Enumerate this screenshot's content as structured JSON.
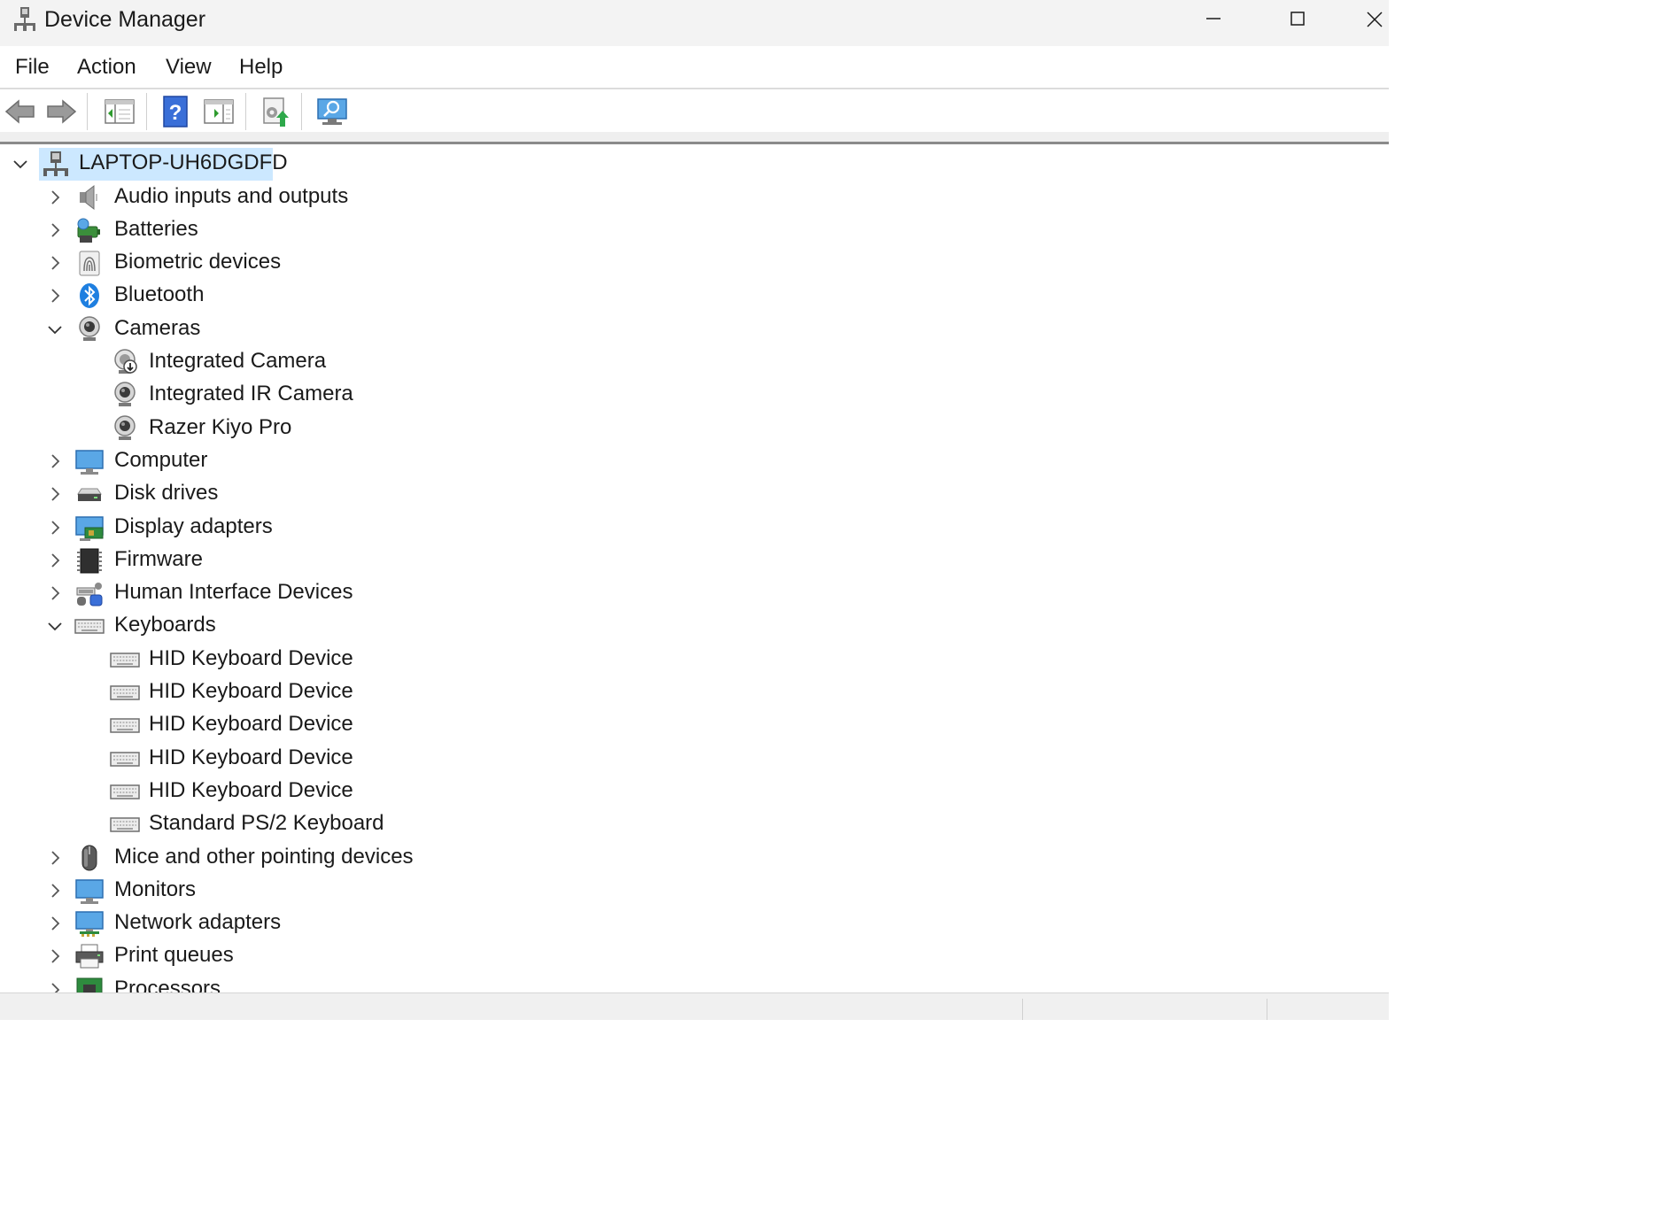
{
  "window": {
    "title": "Device Manager",
    "controls": [
      "minimize",
      "maximize",
      "close"
    ]
  },
  "menu": {
    "items": [
      "File",
      "Action",
      "View",
      "Help"
    ]
  },
  "toolbar": {
    "buttons": [
      {
        "name": "back-button",
        "icon": "arrow-left-icon"
      },
      {
        "name": "forward-button",
        "icon": "arrow-right-icon"
      },
      {
        "name": "show-hide-console-tree-button",
        "icon": "console-tree-icon"
      },
      {
        "name": "help-button",
        "icon": "help-icon"
      },
      {
        "name": "show-hide-action-pane-button",
        "icon": "action-pane-icon"
      },
      {
        "name": "update-driver-button",
        "icon": "update-driver-icon"
      },
      {
        "name": "scan-hardware-changes-button",
        "icon": "scan-hardware-icon"
      }
    ]
  },
  "tree": {
    "root": {
      "label": "LAPTOP-UH6DGDFD",
      "icon": "computer-network-icon",
      "expanded": true,
      "selected": true
    },
    "rows": [
      {
        "label": "Audio inputs and outputs",
        "icon": "speaker-icon",
        "level": 1,
        "expanded": false
      },
      {
        "label": "Batteries",
        "icon": "battery-icon",
        "level": 1,
        "expanded": false
      },
      {
        "label": "Biometric devices",
        "icon": "fingerprint-icon",
        "level": 1,
        "expanded": false
      },
      {
        "label": "Bluetooth",
        "icon": "bluetooth-icon",
        "level": 1,
        "expanded": false
      },
      {
        "label": "Cameras",
        "icon": "webcam-icon",
        "level": 1,
        "expanded": true
      },
      {
        "label": "Integrated Camera",
        "icon": "webcam-warning-icon",
        "level": 2
      },
      {
        "label": "Integrated IR Camera",
        "icon": "webcam-icon",
        "level": 2
      },
      {
        "label": "Razer Kiyo Pro",
        "icon": "webcam-icon",
        "level": 2
      },
      {
        "label": "Computer",
        "icon": "monitor-icon",
        "level": 1,
        "expanded": false
      },
      {
        "label": "Disk drives",
        "icon": "disk-drive-icon",
        "level": 1,
        "expanded": false
      },
      {
        "label": "Display adapters",
        "icon": "display-adapter-icon",
        "level": 1,
        "expanded": false
      },
      {
        "label": "Firmware",
        "icon": "chip-icon",
        "level": 1,
        "expanded": false
      },
      {
        "label": "Human Interface Devices",
        "icon": "hid-icon",
        "level": 1,
        "expanded": false
      },
      {
        "label": "Keyboards",
        "icon": "keyboard-icon",
        "level": 1,
        "expanded": true
      },
      {
        "label": "HID Keyboard Device",
        "icon": "keyboard-icon",
        "level": 2
      },
      {
        "label": "HID Keyboard Device",
        "icon": "keyboard-icon",
        "level": 2
      },
      {
        "label": "HID Keyboard Device",
        "icon": "keyboard-icon",
        "level": 2
      },
      {
        "label": "HID Keyboard Device",
        "icon": "keyboard-icon",
        "level": 2
      },
      {
        "label": "HID Keyboard Device",
        "icon": "keyboard-icon",
        "level": 2
      },
      {
        "label": "Standard PS/2 Keyboard",
        "icon": "keyboard-icon",
        "level": 2
      },
      {
        "label": "Mice and other pointing devices",
        "icon": "mouse-icon",
        "level": 1,
        "expanded": false
      },
      {
        "label": "Monitors",
        "icon": "monitor-icon",
        "level": 1,
        "expanded": false
      },
      {
        "label": "Network adapters",
        "icon": "network-adapter-icon",
        "level": 1,
        "expanded": false
      },
      {
        "label": "Print queues",
        "icon": "printer-icon",
        "level": 1,
        "expanded": false
      },
      {
        "label": "Processors",
        "icon": "processor-icon",
        "level": 1,
        "expanded": false
      }
    ]
  },
  "colors": {
    "selection": "#cce8ff",
    "titlebar": "#f3f3f3",
    "accent": "#1e90ff"
  }
}
